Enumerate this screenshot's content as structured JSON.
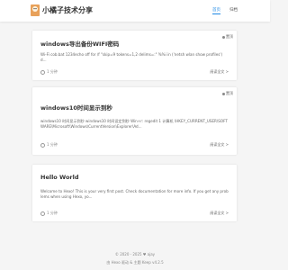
{
  "header": {
    "site_title": "小橘子技术分享",
    "nav": [
      {
        "label": "首页",
        "active": true
      },
      {
        "label": "归档",
        "active": false
      }
    ]
  },
  "posts": [
    {
      "title": "windows导出备份WIFI密码",
      "pinned_label": "置顶",
      "excerpt": "Wi-Fi cob.bat 1234echo off for /f \"skip=9 tokens=1,2 delims=:\" %%i in ('netsh wlan show profiles') d...",
      "meta": "1 分钟",
      "read_more": "阅读全文 >"
    },
    {
      "title": "windows10时间显示到秒",
      "pinned_label": "置顶",
      "excerpt": "windows10 时间显示到秒 windows10 时间设定到秒 Win+r: regedit 1 计算机 \\HKEY_CURRENT_USER\\SOFTWARE\\Microsoft\\Windows\\CurrentVersion\\Explorer\\Ad...",
      "meta": "1 分钟",
      "read_more": "阅读全文 >"
    },
    {
      "title": "Hello World",
      "pinned_label": "",
      "excerpt": "Welcome to Hexo! This is your very first post. Check documentation for more info. If you get any problems when using Hexo, yo...",
      "meta": "1 分钟",
      "read_more": "阅读全文 >"
    }
  ],
  "footer": {
    "line1": "© 2020 - 2025 ♥ ajay",
    "line2": "由 Hexo 驱动 & 主题 Keep v4.2.5"
  }
}
